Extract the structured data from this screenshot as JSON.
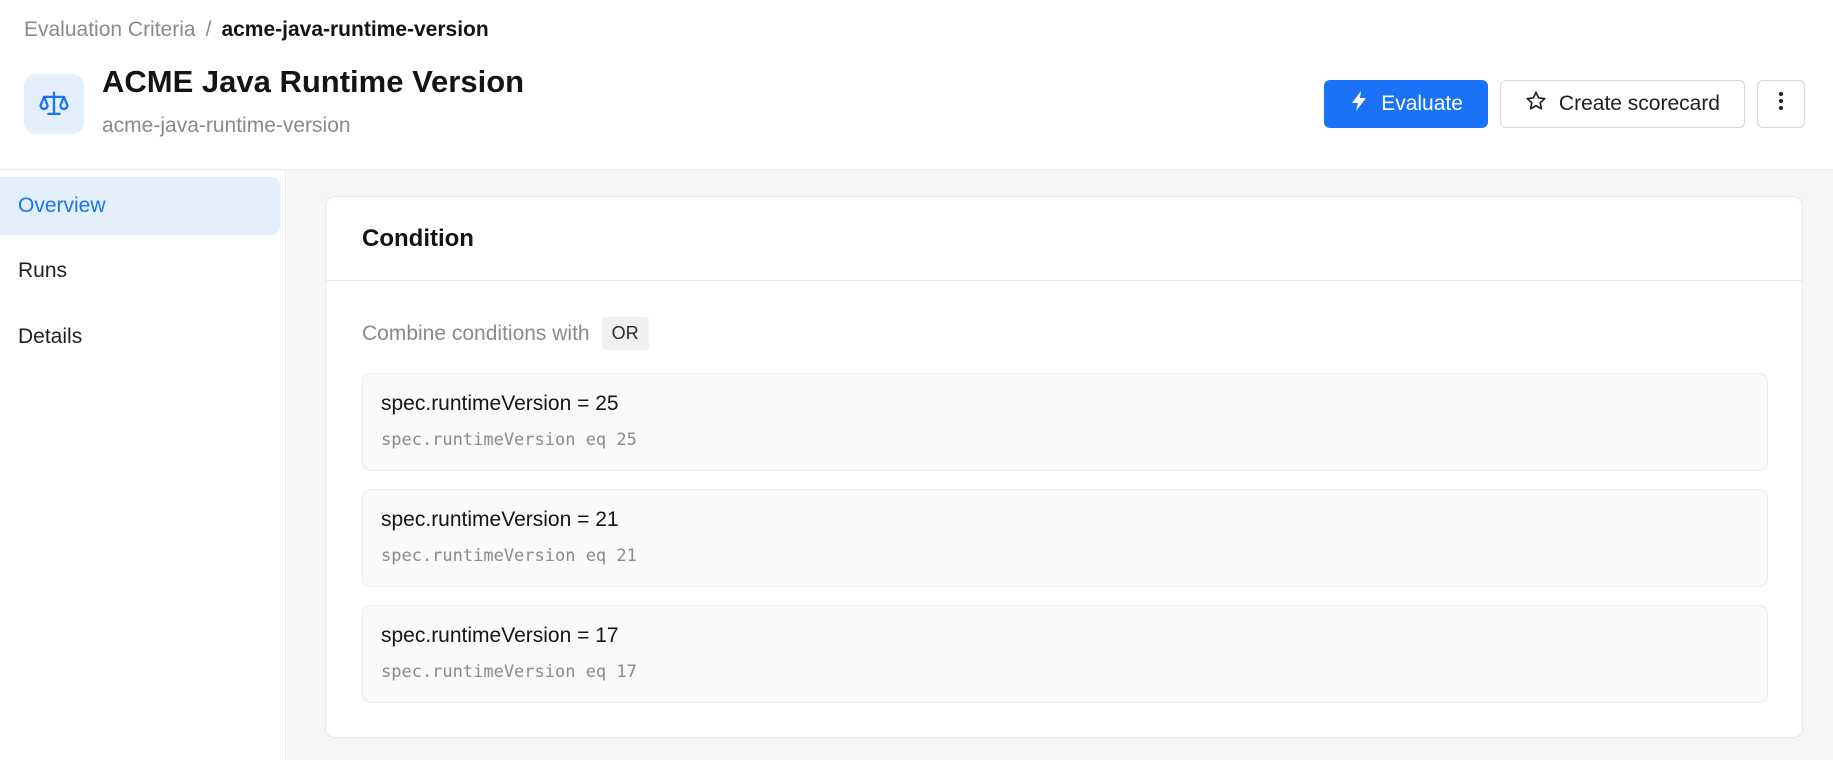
{
  "breadcrumb": {
    "parent": "Evaluation Criteria",
    "separator": "/",
    "current": "acme-java-runtime-version"
  },
  "header": {
    "icon": "scale-icon",
    "title": "ACME Java Runtime Version",
    "subtitle": "acme-java-runtime-version"
  },
  "actions": {
    "evaluate_label": "Evaluate",
    "evaluate_icon": "lightning-icon",
    "scorecard_label": "Create scorecard",
    "scorecard_icon": "star-icon",
    "more_icon": "kebab-menu-icon"
  },
  "sidebar": {
    "items": [
      {
        "label": "Overview",
        "active": true
      },
      {
        "label": "Runs",
        "active": false
      },
      {
        "label": "Details",
        "active": false
      }
    ]
  },
  "condition": {
    "title": "Condition",
    "combine_label": "Combine conditions with",
    "operator": "OR",
    "items": [
      {
        "expression": "spec.runtimeVersion = 25",
        "code": "spec.runtimeVersion eq 25"
      },
      {
        "expression": "spec.runtimeVersion = 21",
        "code": "spec.runtimeVersion eq 21"
      },
      {
        "expression": "spec.runtimeVersion = 17",
        "code": "spec.runtimeVersion eq 17"
      }
    ]
  },
  "colors": {
    "accent": "#1a73f6",
    "accent_light": "#e3f0fc",
    "muted_text": "#8a8a8a",
    "background": "#f5f5f5"
  }
}
